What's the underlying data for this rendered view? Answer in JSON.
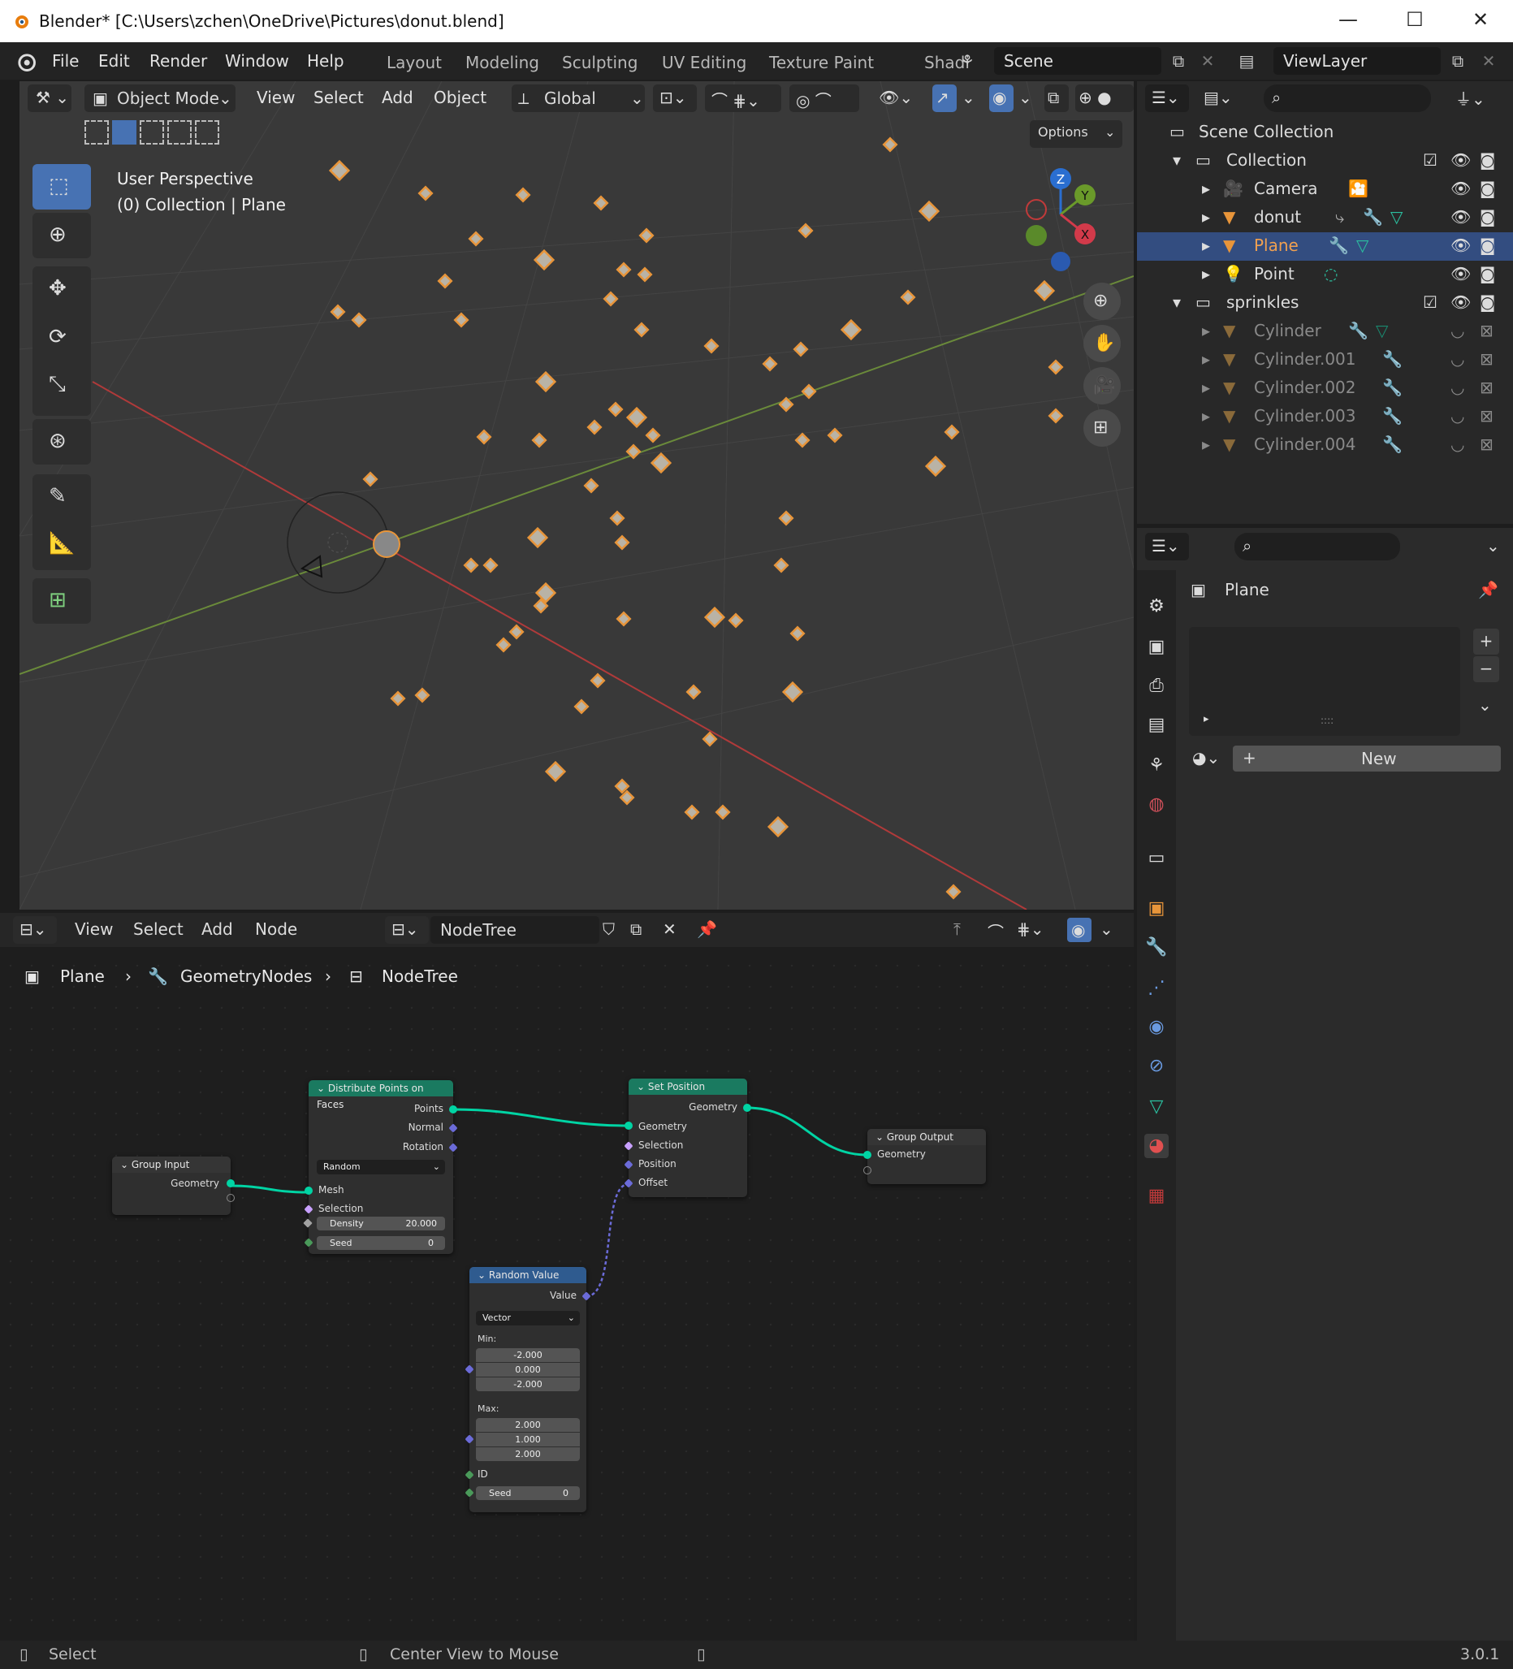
{
  "window": {
    "title": "Blender* [C:\\Users\\zchen\\OneDrive\\Pictures\\donut.blend]"
  },
  "topbar": {
    "menus": [
      "File",
      "Edit",
      "Render",
      "Window",
      "Help"
    ],
    "workspaces": [
      "Layout",
      "Modeling",
      "Sculpting",
      "UV Editing",
      "Texture Paint",
      "Shadi"
    ],
    "scene": "Scene",
    "view_layer": "ViewLayer"
  },
  "viewport": {
    "mode": "Object Mode",
    "menus": [
      "View",
      "Select",
      "Add",
      "Object"
    ],
    "transform_orientation": "Global",
    "options_label": "Options",
    "info_line1": "User Perspective",
    "info_line2": "(0) Collection | Plane",
    "gizmo": {
      "z": "Z",
      "y": "Y",
      "x": "X"
    }
  },
  "outliner": {
    "scene_collection": "Scene Collection",
    "collection": "Collection",
    "items": [
      "Camera",
      "donut",
      "Plane",
      "Point"
    ],
    "sprinkles": "sprinkles",
    "sprinkle_items": [
      "Cylinder",
      "Cylinder.001",
      "Cylinder.002",
      "Cylinder.003",
      "Cylinder.004"
    ]
  },
  "properties": {
    "object_name": "Plane",
    "new_label": "New",
    "list_handle": "::::"
  },
  "node_editor": {
    "menus": [
      "View",
      "Select",
      "Add",
      "Node"
    ],
    "tree_name": "NodeTree",
    "breadcrumb": [
      "Plane",
      "GeometryNodes",
      "NodeTree"
    ],
    "nodes": {
      "group_input": {
        "title": "Group Input",
        "geometry": "Geometry"
      },
      "distribute": {
        "title": "Distribute Points on Faces",
        "points": "Points",
        "normal": "Normal",
        "rotation": "Rotation",
        "mode": "Random",
        "mesh": "Mesh",
        "selection": "Selection",
        "density_label": "Density",
        "density_value": "20.000",
        "seed_label": "Seed",
        "seed_value": "0"
      },
      "set_position": {
        "title": "Set Position",
        "geometry_out": "Geometry",
        "geometry": "Geometry",
        "selection": "Selection",
        "position": "Position",
        "offset": "Offset"
      },
      "group_output": {
        "title": "Group Output",
        "geometry": "Geometry"
      },
      "random_value": {
        "title": "Random Value",
        "value": "Value",
        "type": "Vector",
        "min_label": "Min:",
        "min": [
          "-2.000",
          "0.000",
          "-2.000"
        ],
        "max_label": "Max:",
        "max": [
          "2.000",
          "1.000",
          "2.000"
        ],
        "id": "ID",
        "seed_label": "Seed",
        "seed_value": "0"
      }
    }
  },
  "statusbar": {
    "left": "Select",
    "middle": "Center View to Mouse",
    "version": "3.0.1"
  },
  "colors": {
    "accent": "#4772b3",
    "selection_orange": "#e8953a",
    "geometry_socket": "#00d4a4",
    "vector_socket": "#6b6bd8"
  }
}
